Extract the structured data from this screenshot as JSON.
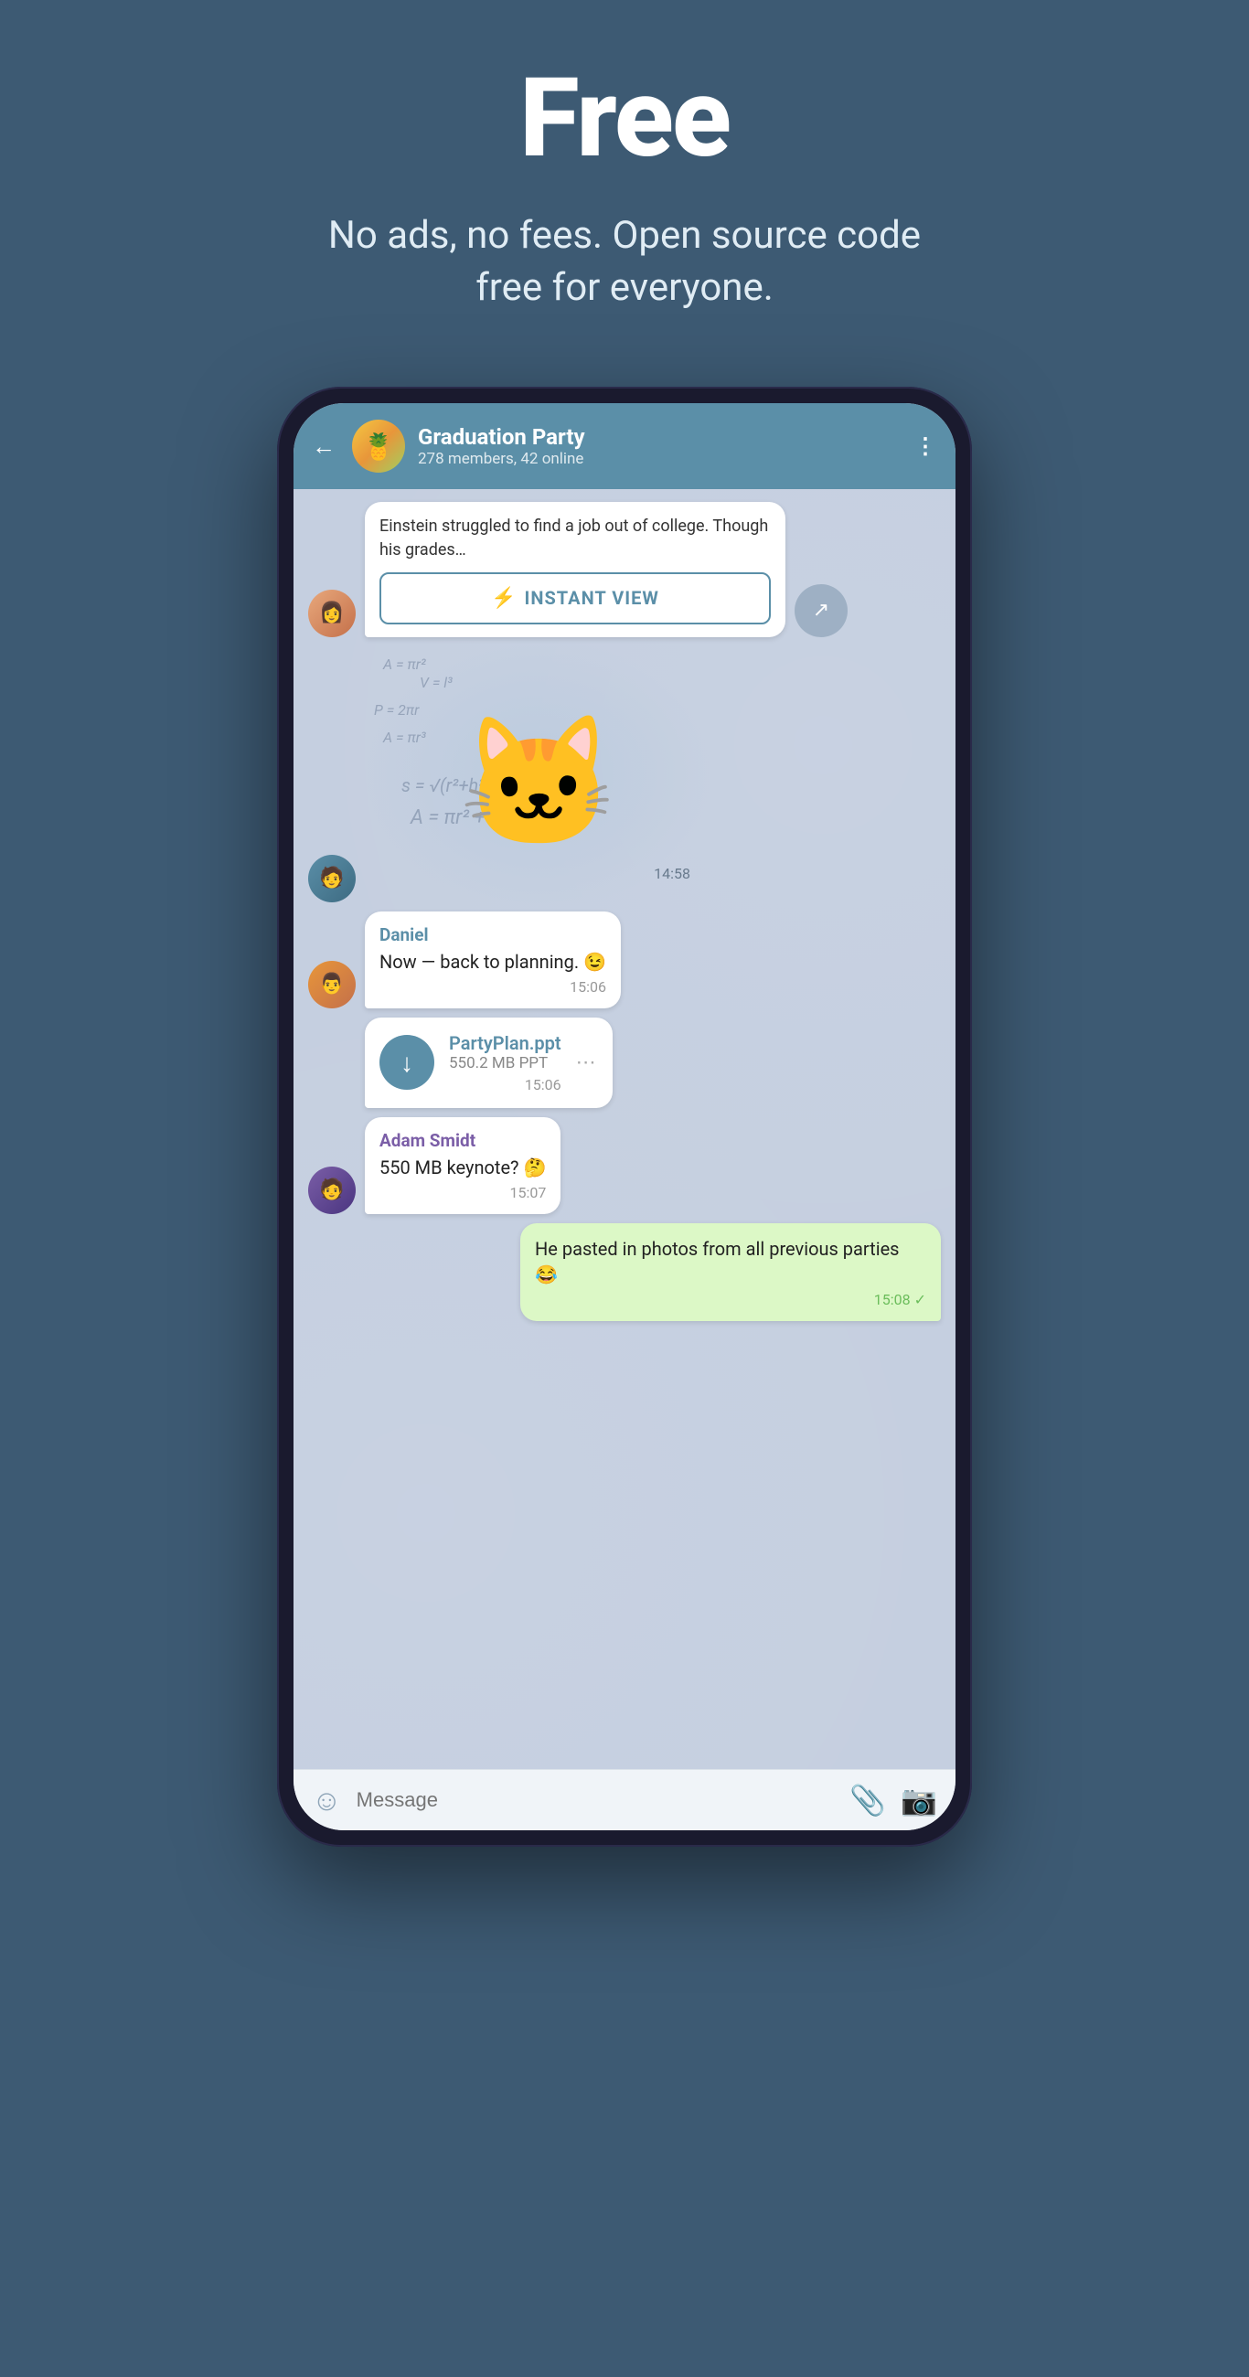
{
  "hero": {
    "title": "Free",
    "subtitle": "No ads, no fees. Open source code free for everyone."
  },
  "phone": {
    "header": {
      "group_name": "Graduation Party",
      "meta": "278 members, 42 online",
      "back_label": "←",
      "more_label": "⋮"
    },
    "messages": [
      {
        "id": "link-preview",
        "type": "link",
        "excerpt": "Einstein struggled to find a job out of college. Though his grades…",
        "instant_view_label": "INSTANT VIEW"
      },
      {
        "id": "sticker",
        "type": "sticker",
        "timestamp": "14:58"
      },
      {
        "id": "daniel-msg",
        "type": "text",
        "sender": "Daniel",
        "text": "Now — back to planning. 😉",
        "timestamp": "15:06"
      },
      {
        "id": "file-msg",
        "type": "file",
        "file_name": "PartyPlan.ppt",
        "file_size": "550.2 MB PPT",
        "timestamp": "15:06"
      },
      {
        "id": "adam-msg",
        "type": "text",
        "sender": "Adam Smidt",
        "text": "550 MB keynote? 🤔",
        "timestamp": "15:07"
      },
      {
        "id": "self-msg",
        "type": "outgoing",
        "text": "He pasted in photos from all previous parties 😂",
        "timestamp": "15:08",
        "status": "✓"
      }
    ],
    "input": {
      "placeholder": "Message",
      "emoji_icon": "☺",
      "attach_icon": "📎",
      "camera_icon": "📷"
    }
  }
}
